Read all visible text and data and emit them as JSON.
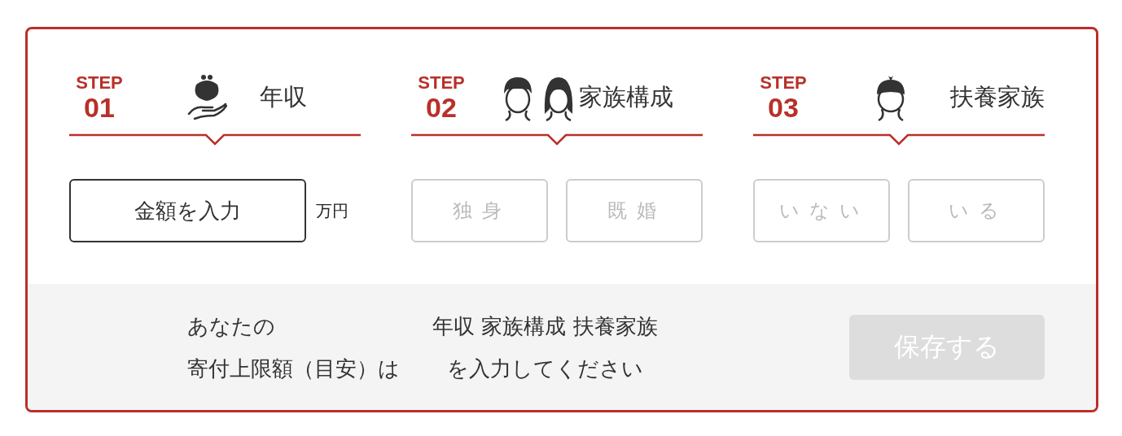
{
  "steps": [
    {
      "label": "STEP",
      "number": "01",
      "title": "年収",
      "kind": "amount",
      "button": "金額を入力",
      "unit": "万円"
    },
    {
      "label": "STEP",
      "number": "02",
      "title": "家族構成",
      "kind": "choices",
      "options": [
        {
          "label": "独身",
          "disabled": true
        },
        {
          "label": "既婚",
          "disabled": true
        }
      ]
    },
    {
      "label": "STEP",
      "number": "03",
      "title": "扶養家族",
      "kind": "choices",
      "options": [
        {
          "label": "いない",
          "disabled": true
        },
        {
          "label": "いる",
          "disabled": true
        }
      ]
    }
  ],
  "result": {
    "label_lines": [
      "あなたの",
      "寄付上限額（目安）は"
    ],
    "message_lines": [
      "年収 家族構成 扶養家族",
      "を入力してください"
    ],
    "save_button": {
      "label": "保存する",
      "disabled": true
    }
  }
}
